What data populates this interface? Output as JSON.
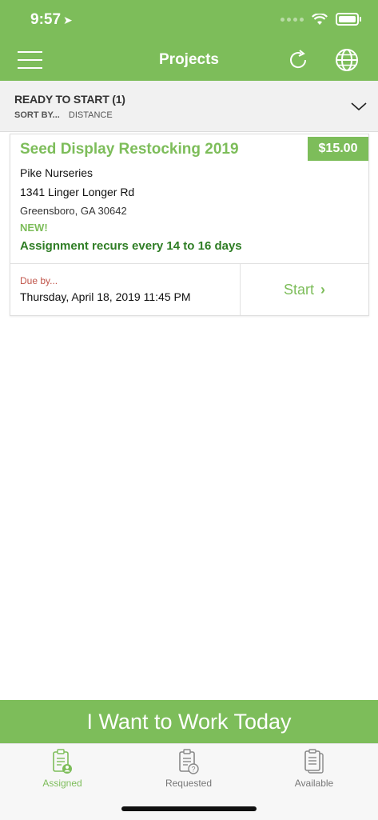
{
  "status_bar": {
    "time": "9:57"
  },
  "header": {
    "title": "Projects"
  },
  "filter": {
    "title": "READY TO START (1)",
    "sort_label": "SORT BY...",
    "sort_value": "DISTANCE"
  },
  "project": {
    "title": "Seed Display Restocking 2019",
    "price": "$15.00",
    "store": "Pike Nurseries",
    "street": "1341 Linger Longer Rd",
    "city": "Greensboro, GA 30642",
    "badge": "NEW!",
    "recurrence": "Assignment recurs every 14 to 16 days",
    "due_label": "Due by...",
    "due_date": "Thursday, April 18, 2019 11:45 PM",
    "start_label": "Start",
    "start_arrow": "›"
  },
  "work_today": {
    "label": "I Want to Work Today"
  },
  "tabs": [
    {
      "label": "Assigned",
      "icon": "clipboard-user-icon",
      "active": true
    },
    {
      "label": "Requested",
      "icon": "clipboard-question-icon",
      "active": false
    },
    {
      "label": "Available",
      "icon": "clipboard-stack-icon",
      "active": false
    }
  ],
  "colors": {
    "brand": "#7dbd5a",
    "recurrence": "#2e7d24",
    "due_label": "#c0554a"
  }
}
